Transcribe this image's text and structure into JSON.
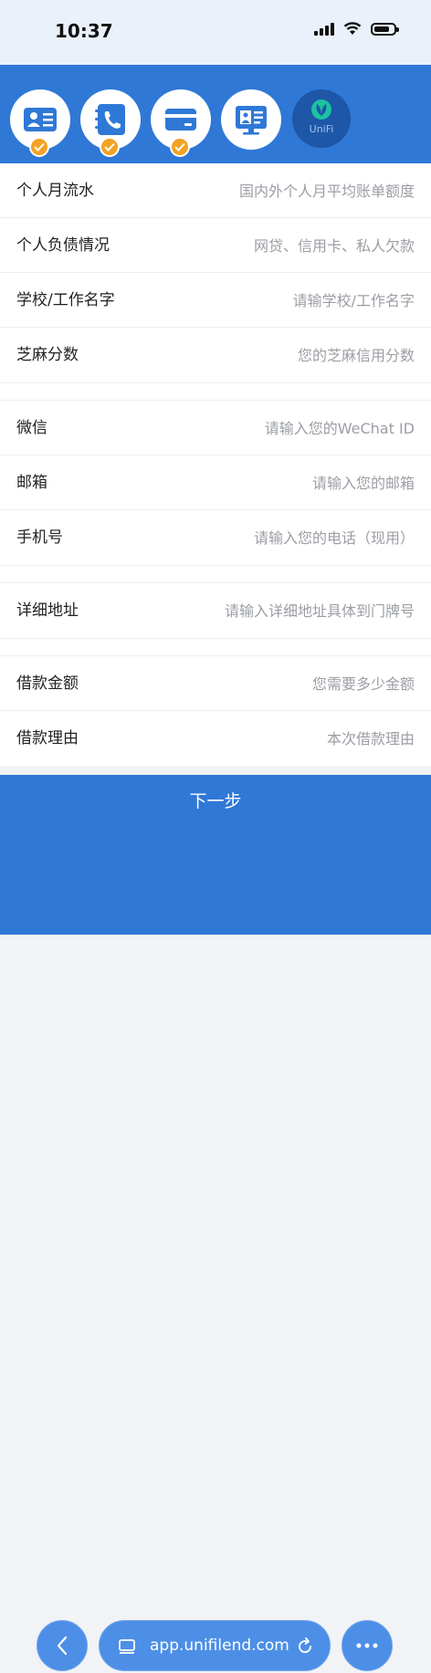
{
  "status_bar": {
    "time": "10:37"
  },
  "steps": {
    "brand_label": "UniFi"
  },
  "form": {
    "rows": [
      {
        "label": "个人月流水",
        "placeholder": "国内外个人月平均账单额度"
      },
      {
        "label": "个人负债情况",
        "placeholder": "网贷、信用卡、私人欠款"
      },
      {
        "label": "学校/工作名字",
        "placeholder": "请输学校/工作名字"
      },
      {
        "label": "芝麻分数",
        "placeholder": "您的芝麻信用分数"
      },
      {
        "label": "微信",
        "placeholder": "请输入您的WeChat ID"
      },
      {
        "label": "邮箱",
        "placeholder": "请输入您的邮箱"
      },
      {
        "label": "手机号",
        "placeholder": "请输入您的电话（现用）"
      },
      {
        "label": "详细地址",
        "placeholder": "请输入详细地址具体到门牌号"
      },
      {
        "label": "借款金额",
        "placeholder": "您需要多少金额"
      },
      {
        "label": "借款理由",
        "placeholder": "本次借款理由"
      }
    ]
  },
  "footer": {
    "next_label": "下一步"
  },
  "browser": {
    "url": "app.unifilend.com"
  },
  "colors": {
    "brand_blue": "#2f78d6",
    "check_orange": "#f3a223"
  }
}
